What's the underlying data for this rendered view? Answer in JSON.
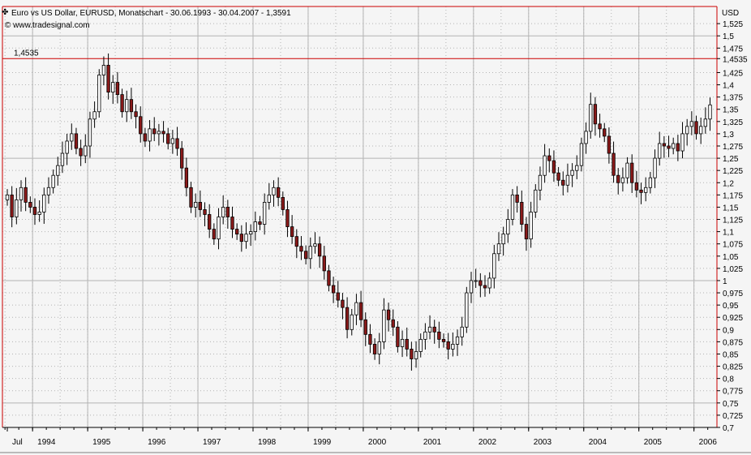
{
  "header": {
    "title": "Euro vs US Dollar, EURUSD, Monatschart - 30.06.1993 - 30.04.2007 - 1,3591",
    "credit": "© www.tradesignal.com",
    "currency_label": "USD"
  },
  "colors": {
    "background": "#f5f5f5",
    "grid": "#b4b4b4",
    "axis": "#cc0000",
    "candle_up": "#ffffff",
    "candle_down": "#8b1a1a",
    "candle_outline": "#000000",
    "reference_line": "#cc0000"
  },
  "chart_data": {
    "type": "candlestick",
    "title": "Euro vs US Dollar, EURUSD, Monatschart - 30.06.1993 - 30.04.2007 - 1,3591",
    "ylabel": "USD",
    "ylim": [
      0.7,
      1.56
    ],
    "x_tick_labels": [
      "Jul",
      "1994",
      "1995",
      "1996",
      "1997",
      "1998",
      "1999",
      "2000",
      "2001",
      "2002",
      "2003",
      "2004",
      "2005",
      "2006"
    ],
    "y_tick_labels": [
      "1,525",
      "1,5",
      "1,475",
      "1,4535",
      "1,425",
      "1,4",
      "1,375",
      "1,35",
      "1,325",
      "1,3",
      "1,275",
      "1,25",
      "1,225",
      "1,2",
      "1,175",
      "1,15",
      "1,125",
      "1,1",
      "1,075",
      "1,05",
      "1,025",
      "1",
      "0,975",
      "0,95",
      "0,925",
      "0,9",
      "0,875",
      "0,85",
      "0,825",
      "0,8",
      "0,775",
      "0,75",
      "0,725",
      "0,7"
    ],
    "reference_line": {
      "value": 1.4535,
      "label": "1,4535"
    },
    "close_series": [
      1.175,
      1.13,
      1.165,
      1.19,
      1.16,
      1.15,
      1.135,
      1.14,
      1.175,
      1.19,
      1.215,
      1.235,
      1.26,
      1.285,
      1.3,
      1.27,
      1.255,
      1.275,
      1.33,
      1.345,
      1.42,
      1.44,
      1.385,
      1.405,
      1.38,
      1.345,
      1.37,
      1.345,
      1.335,
      1.3,
      1.285,
      1.31,
      1.3,
      1.305,
      1.3,
      1.28,
      1.29,
      1.27,
      1.23,
      1.19,
      1.15,
      1.16,
      1.145,
      1.135,
      1.105,
      1.085,
      1.13,
      1.15,
      1.13,
      1.105,
      1.095,
      1.08,
      1.095,
      1.1,
      1.12,
      1.115,
      1.16,
      1.175,
      1.19,
      1.17,
      1.145,
      1.11,
      1.09,
      1.07,
      1.06,
      1.045,
      1.07,
      1.075,
      1.05,
      1.02,
      0.99,
      0.975,
      0.96,
      0.945,
      0.9,
      0.93,
      0.955,
      0.92,
      0.89,
      0.87,
      0.85,
      0.875,
      0.94,
      0.92,
      0.905,
      0.865,
      0.88,
      0.86,
      0.84,
      0.855,
      0.88,
      0.895,
      0.905,
      0.895,
      0.88,
      0.875,
      0.86,
      0.87,
      0.885,
      0.905,
      0.975,
      1,
      1,
      0.99,
      0.985,
      1.005,
      1.055,
      1.075,
      1.095,
      1.125,
      1.175,
      1.16,
      1.115,
      1.085,
      1.14,
      1.185,
      1.215,
      1.255,
      1.245,
      1.22,
      1.205,
      1.195,
      1.215,
      1.225,
      1.235,
      1.28,
      1.305,
      1.36,
      1.32,
      1.31,
      1.295,
      1.26,
      1.215,
      1.2,
      1.21,
      1.24,
      1.2,
      1.185,
      1.18,
      1.19,
      1.21,
      1.25,
      1.28,
      1.275,
      1.27,
      1.28,
      1.265,
      1.3,
      1.315,
      1.325,
      1.3,
      1.315,
      1.33,
      1.359
    ]
  }
}
